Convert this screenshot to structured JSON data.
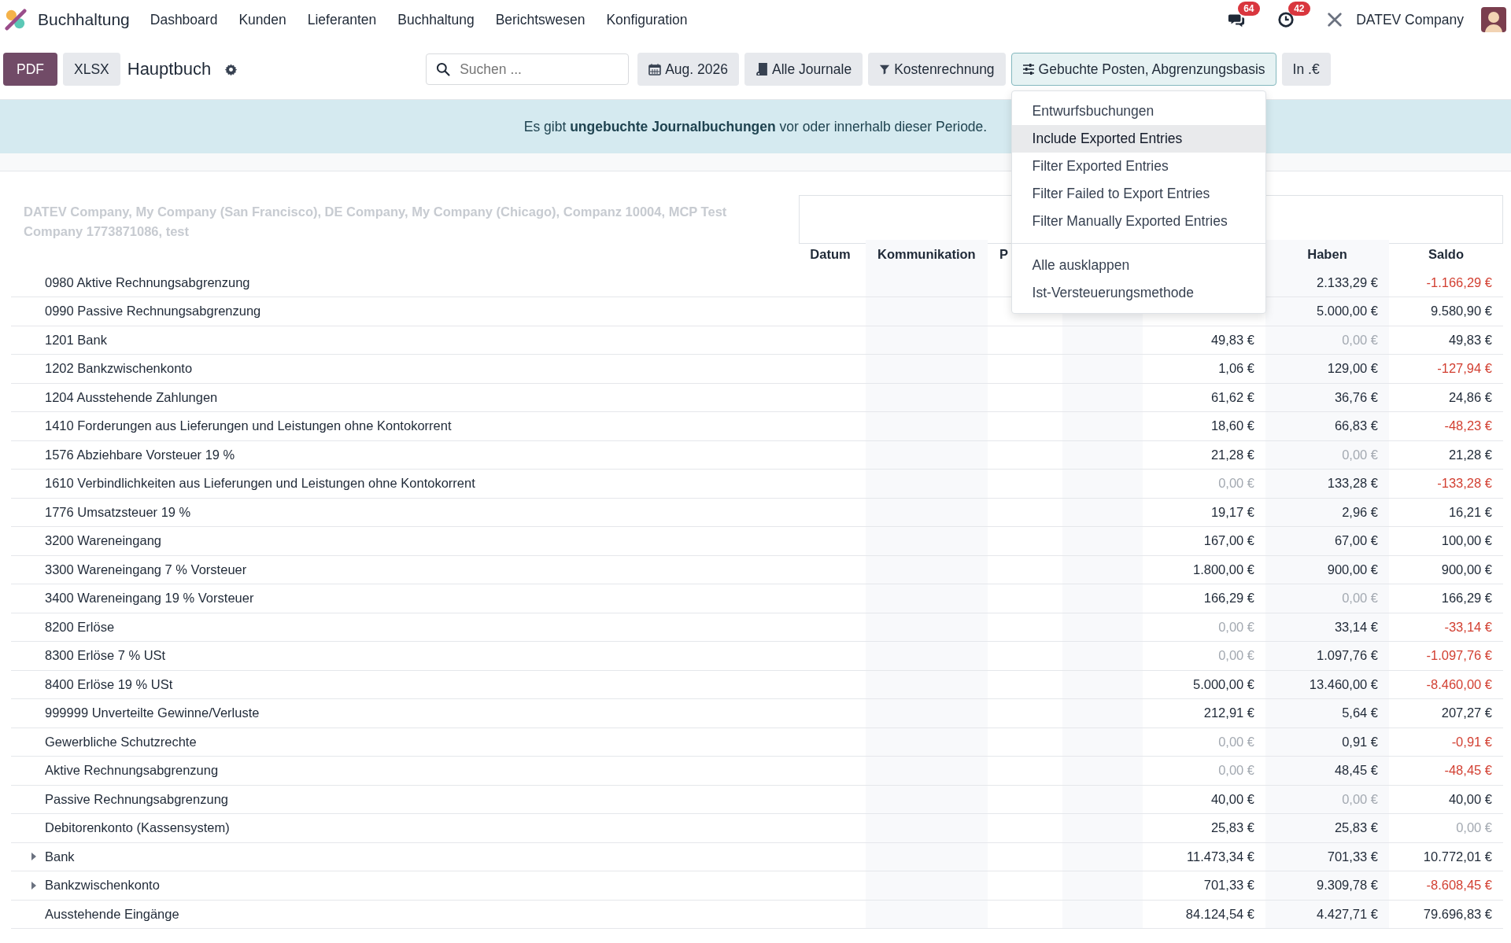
{
  "navbar": {
    "app_name": "Buchhaltung",
    "menu": [
      "Dashboard",
      "Kunden",
      "Lieferanten",
      "Buchhaltung",
      "Berichtswesen",
      "Konfiguration"
    ],
    "messages_count": "64",
    "activities_count": "42",
    "company": "DATEV Company"
  },
  "toolbar": {
    "buttons": [
      {
        "label": "PDF",
        "kind": "primary"
      },
      {
        "label": "XLSX",
        "kind": "secondary"
      }
    ],
    "title": "Hauptbuch",
    "search": {
      "placeholder": "Suchen ..."
    },
    "filters": [
      {
        "label": "Aug. 2026",
        "kind": "calendar",
        "open": false
      },
      {
        "label": "Alle Journale",
        "kind": "book",
        "open": false
      },
      {
        "label": "Kostenrechnung",
        "kind": "filter",
        "open": false
      },
      {
        "label": "Gebuchte Posten, Abgrenzungsbasis",
        "kind": "sliders",
        "open": true
      },
      {
        "label": "In .€",
        "kind": "none",
        "open": false
      }
    ]
  },
  "dropdown": {
    "groups": [
      [
        {
          "label": "Entwurfsbuchungen",
          "highlighted": false
        },
        {
          "label": "Include Exported Entries",
          "highlighted": true
        },
        {
          "label": "Filter Exported Entries",
          "highlighted": false
        },
        {
          "label": "Filter Failed to Export Entries",
          "highlighted": false
        },
        {
          "label": "Filter Manually Exported Entries",
          "highlighted": false
        }
      ],
      [
        {
          "label": "Alle ausklappen",
          "highlighted": false
        },
        {
          "label": "Ist-Versteuerungsmethode",
          "highlighted": false
        }
      ]
    ]
  },
  "alert": "Es gibt **ungebuchte Journalbuchungen** vor oder innerhalb dieser Periode.",
  "report": {
    "companies": "DATEV Company, My Company (San Francisco), DE Company, My Company (Chicago), Companz 10004, MCP Test Company 1773871086, test",
    "columns": [
      "Datum",
      "Kommunikation",
      "P",
      "Haben",
      "Saldo"
    ],
    "rows": [
      {
        "name": "0980 Aktive Rechnungsabgrenzung",
        "expandable": false,
        "haben": {
          "text": "2.133,29 €",
          "muted": false,
          "negative": false
        },
        "saldo": {
          "text": "-1.166,29 €",
          "muted": false,
          "negative": true
        }
      },
      {
        "name": "0990 Passive Rechnungsabgrenzung",
        "expandable": false,
        "haben": {
          "text": "5.000,00 €",
          "muted": false,
          "negative": false
        },
        "saldo": {
          "text": "9.580,90 €",
          "muted": false,
          "negative": false
        }
      },
      {
        "name": "1201 Bank",
        "expandable": false,
        "soll": {
          "text": "49,83 €",
          "muted": false,
          "negative": false
        },
        "haben": {
          "text": "0,00 €",
          "muted": true,
          "negative": false
        },
        "saldo": {
          "text": "49,83 €",
          "muted": false,
          "negative": false
        }
      },
      {
        "name": "1202 Bankzwischenkonto",
        "expandable": false,
        "soll": {
          "text": "1,06 €",
          "muted": false,
          "negative": false
        },
        "haben": {
          "text": "129,00 €",
          "muted": false,
          "negative": false
        },
        "saldo": {
          "text": "-127,94 €",
          "muted": false,
          "negative": true
        }
      },
      {
        "name": "1204 Ausstehende Zahlungen",
        "expandable": false,
        "soll": {
          "text": "61,62 €",
          "muted": false,
          "negative": false
        },
        "haben": {
          "text": "36,76 €",
          "muted": false,
          "negative": false
        },
        "saldo": {
          "text": "24,86 €",
          "muted": false,
          "negative": false
        }
      },
      {
        "name": "1410 Forderungen aus Lieferungen und Leistungen ohne Kontokorrent",
        "expandable": false,
        "soll": {
          "text": "18,60 €",
          "muted": false,
          "negative": false
        },
        "haben": {
          "text": "66,83 €",
          "muted": false,
          "negative": false
        },
        "saldo": {
          "text": "-48,23 €",
          "muted": false,
          "negative": true
        }
      },
      {
        "name": "1576 Abziehbare Vorsteuer 19 %",
        "expandable": false,
        "soll": {
          "text": "21,28 €",
          "muted": false,
          "negative": false
        },
        "haben": {
          "text": "0,00 €",
          "muted": true,
          "negative": false
        },
        "saldo": {
          "text": "21,28 €",
          "muted": false,
          "negative": false
        }
      },
      {
        "name": "1610 Verbindlichkeiten aus Lieferungen und Leistungen ohne Kontokorrent",
        "expandable": false,
        "soll": {
          "text": "0,00 €",
          "muted": true,
          "negative": false
        },
        "haben": {
          "text": "133,28 €",
          "muted": false,
          "negative": false
        },
        "saldo": {
          "text": "-133,28 €",
          "muted": false,
          "negative": true
        }
      },
      {
        "name": "1776 Umsatzsteuer 19 %",
        "expandable": false,
        "soll": {
          "text": "19,17 €",
          "muted": false,
          "negative": false
        },
        "haben": {
          "text": "2,96 €",
          "muted": false,
          "negative": false
        },
        "saldo": {
          "text": "16,21 €",
          "muted": false,
          "negative": false
        }
      },
      {
        "name": "3200 Wareneingang",
        "expandable": false,
        "soll": {
          "text": "167,00 €",
          "muted": false,
          "negative": false
        },
        "haben": {
          "text": "67,00 €",
          "muted": false,
          "negative": false
        },
        "saldo": {
          "text": "100,00 €",
          "muted": false,
          "negative": false
        }
      },
      {
        "name": "3300 Wareneingang 7 % Vorsteuer",
        "expandable": false,
        "soll": {
          "text": "1.800,00 €",
          "muted": false,
          "negative": false
        },
        "haben": {
          "text": "900,00 €",
          "muted": false,
          "negative": false
        },
        "saldo": {
          "text": "900,00 €",
          "muted": false,
          "negative": false
        }
      },
      {
        "name": "3400 Wareneingang 19 % Vorsteuer",
        "expandable": false,
        "soll": {
          "text": "166,29 €",
          "muted": false,
          "negative": false
        },
        "haben": {
          "text": "0,00 €",
          "muted": true,
          "negative": false
        },
        "saldo": {
          "text": "166,29 €",
          "muted": false,
          "negative": false
        }
      },
      {
        "name": "8200 Erlöse",
        "expandable": false,
        "soll": {
          "text": "0,00 €",
          "muted": true,
          "negative": false
        },
        "haben": {
          "text": "33,14 €",
          "muted": false,
          "negative": false
        },
        "saldo": {
          "text": "-33,14 €",
          "muted": false,
          "negative": true
        }
      },
      {
        "name": "8300 Erlöse 7 % USt",
        "expandable": false,
        "soll": {
          "text": "0,00 €",
          "muted": true,
          "negative": false
        },
        "haben": {
          "text": "1.097,76 €",
          "muted": false,
          "negative": false
        },
        "saldo": {
          "text": "-1.097,76 €",
          "muted": false,
          "negative": true
        }
      },
      {
        "name": "8400 Erlöse 19 % USt",
        "expandable": false,
        "soll": {
          "text": "5.000,00 €",
          "muted": false,
          "negative": false
        },
        "haben": {
          "text": "13.460,00 €",
          "muted": false,
          "negative": false
        },
        "saldo": {
          "text": "-8.460,00 €",
          "muted": false,
          "negative": true
        }
      },
      {
        "name": "999999 Unverteilte Gewinne/Verluste",
        "expandable": false,
        "soll": {
          "text": "212,91 €",
          "muted": false,
          "negative": false
        },
        "haben": {
          "text": "5,64 €",
          "muted": false,
          "negative": false
        },
        "saldo": {
          "text": "207,27 €",
          "muted": false,
          "negative": false
        }
      },
      {
        "name": "Gewerbliche Schutzrechte",
        "expandable": false,
        "soll": {
          "text": "0,00 €",
          "muted": true,
          "negative": false
        },
        "haben": {
          "text": "0,91 €",
          "muted": false,
          "negative": false
        },
        "saldo": {
          "text": "-0,91 €",
          "muted": false,
          "negative": true
        }
      },
      {
        "name": "Aktive Rechnungsabgrenzung",
        "expandable": false,
        "soll": {
          "text": "0,00 €",
          "muted": true,
          "negative": false
        },
        "haben": {
          "text": "48,45 €",
          "muted": false,
          "negative": false
        },
        "saldo": {
          "text": "-48,45 €",
          "muted": false,
          "negative": true
        }
      },
      {
        "name": "Passive Rechnungsabgrenzung",
        "expandable": false,
        "soll": {
          "text": "40,00 €",
          "muted": false,
          "negative": false
        },
        "haben": {
          "text": "0,00 €",
          "muted": true,
          "negative": false
        },
        "saldo": {
          "text": "40,00 €",
          "muted": false,
          "negative": false
        }
      },
      {
        "name": "Debitorenkonto (Kassensystem)",
        "expandable": false,
        "soll": {
          "text": "25,83 €",
          "muted": false,
          "negative": false
        },
        "haben": {
          "text": "25,83 €",
          "muted": false,
          "negative": false
        },
        "saldo": {
          "text": "0,00 €",
          "muted": true,
          "negative": false
        }
      },
      {
        "name": "Bank",
        "expandable": true,
        "soll": {
          "text": "11.473,34 €",
          "muted": false,
          "negative": false
        },
        "haben": {
          "text": "701,33 €",
          "muted": false,
          "negative": false
        },
        "saldo": {
          "text": "10.772,01 €",
          "muted": false,
          "negative": false
        }
      },
      {
        "name": "Bankzwischenkonto",
        "expandable": true,
        "soll": {
          "text": "701,33 €",
          "muted": false,
          "negative": false
        },
        "haben": {
          "text": "9.309,78 €",
          "muted": false,
          "negative": false
        },
        "saldo": {
          "text": "-8.608,45 €",
          "muted": false,
          "negative": true
        }
      },
      {
        "name": "Ausstehende Eingänge",
        "expandable": false,
        "soll": {
          "text": "84.124,54 €",
          "muted": false,
          "negative": false
        },
        "haben": {
          "text": "4.427,71 €",
          "muted": false,
          "negative": false
        },
        "saldo": {
          "text": "79.696,83 €",
          "muted": false,
          "negative": false
        }
      }
    ]
  }
}
